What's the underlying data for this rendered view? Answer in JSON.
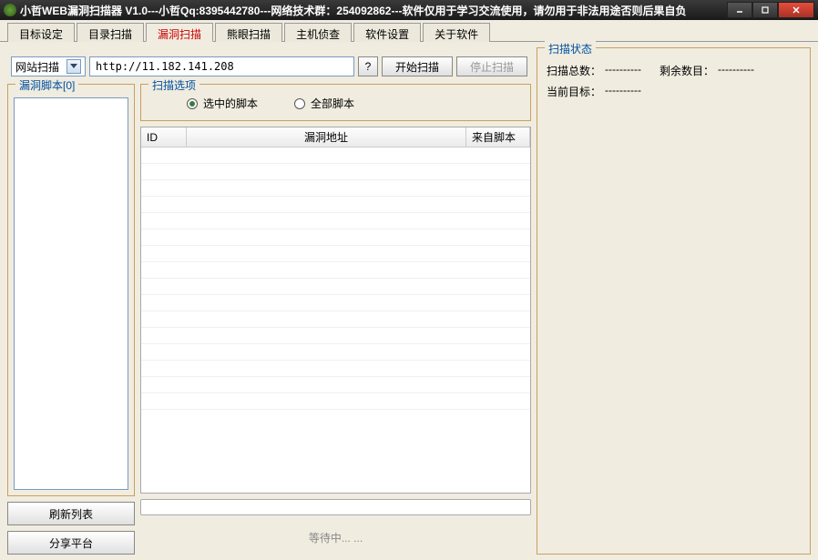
{
  "window": {
    "title": "小哲WEB漏洞扫描器 V1.0---小哲Qq:8395442780---网络技术群：254092862---软件仅用于学习交流使用，请勿用于非法用途否则后果自负"
  },
  "tabs": {
    "items": [
      {
        "label": "目标设定"
      },
      {
        "label": "目录扫描"
      },
      {
        "label": "漏洞扫描"
      },
      {
        "label": "熊眼扫描"
      },
      {
        "label": "主机侦查"
      },
      {
        "label": "软件设置"
      },
      {
        "label": "关于软件"
      }
    ],
    "active_index": 2
  },
  "controls": {
    "scan_type": "网站扫描",
    "url": "http://11.182.141.208",
    "help_btn": "?",
    "start_btn": "开始扫描",
    "stop_btn": "停止扫描"
  },
  "scripts_box": {
    "title": "漏洞脚本[0]",
    "refresh_btn": "刷新列表",
    "share_btn": "分享平台"
  },
  "options_box": {
    "title": "扫描选项",
    "radio_selected": "选中的脚本",
    "radio_all": "全部脚本",
    "checked": "selected"
  },
  "table": {
    "col_id": "ID",
    "col_addr": "漏洞地址",
    "col_src": "来自脚本"
  },
  "progress": {
    "status": "等待中... ..."
  },
  "status_box": {
    "title": "扫描状态",
    "total_label": "扫描总数：",
    "total_value": "----------",
    "remain_label": "剩余数目：",
    "remain_value": "----------",
    "current_label": "当前目标：",
    "current_value": "----------"
  }
}
